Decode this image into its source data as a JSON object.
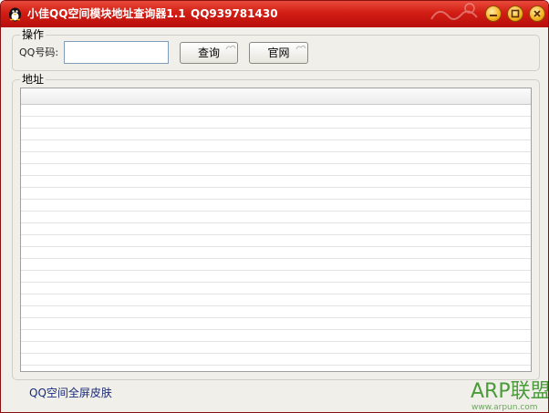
{
  "window": {
    "title": "小佳QQ空间模块地址查询器1.1",
    "title_qq": "QQ939781430",
    "minimize_icon": "minimize-icon",
    "maximize_icon": "maximize-icon",
    "close_icon": "close-icon",
    "accent_color": "#d21d14"
  },
  "operation_group": {
    "label": "操作",
    "qq_label": "QQ号码:",
    "qq_input_value": "",
    "query_button": "查询",
    "website_button": "官网"
  },
  "address_group": {
    "label": "地址",
    "rows": []
  },
  "footer": {
    "link": "QQ空间全屏皮肤"
  },
  "watermark": {
    "brand": "ARP联盟",
    "url": "www.arpun.com"
  }
}
